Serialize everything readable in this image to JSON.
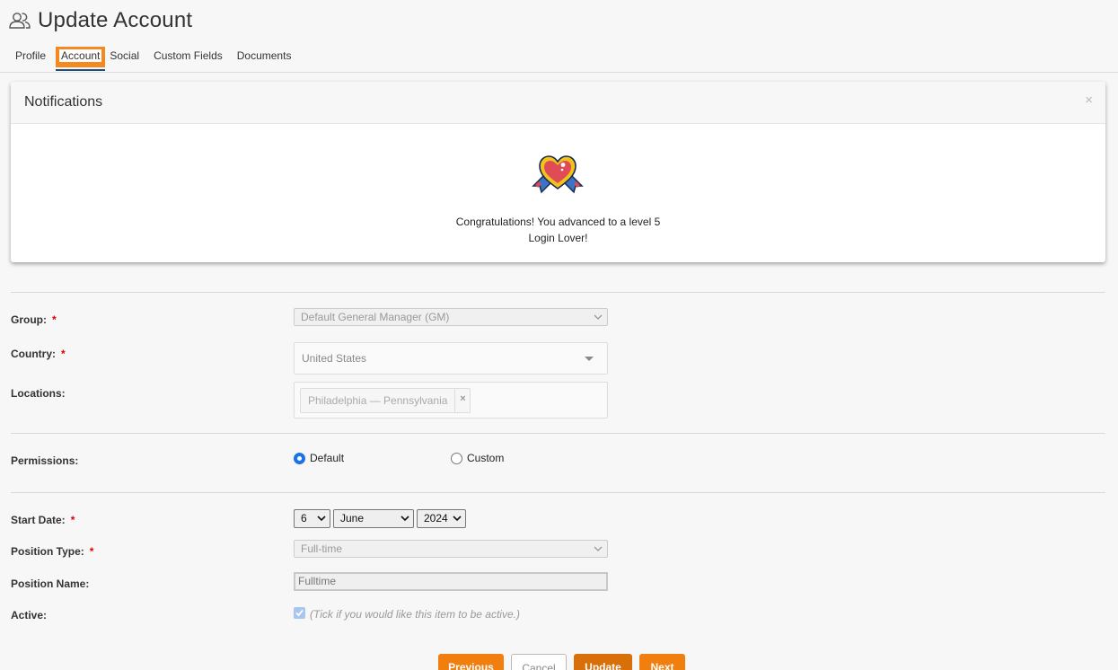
{
  "header": {
    "title": "Update Account",
    "icon": "users-icon"
  },
  "tabs": [
    {
      "label": "Profile",
      "active": false
    },
    {
      "label": "Account",
      "active": true
    },
    {
      "label": "Social",
      "active": false
    },
    {
      "label": "Custom Fields",
      "active": false
    },
    {
      "label": "Documents",
      "active": false
    }
  ],
  "notification": {
    "title": "Notifications",
    "close": "×",
    "badge_icon": "heart-ribbon-badge-icon",
    "message_line1": "Congratulations! You advanced to a level 5",
    "message_line2": "Login Lover!"
  },
  "form": {
    "group": {
      "label": "Group:",
      "required": "*",
      "value": "Default General Manager (GM)"
    },
    "country": {
      "label": "Country:",
      "required": "*",
      "value": "United States"
    },
    "locations": {
      "label": "Locations:",
      "chip": "Philadelphia — Pennsylvania",
      "chip_remove": "×"
    },
    "permissions": {
      "label": "Permissions:",
      "options": [
        "Default",
        "Custom"
      ],
      "selected": "Default"
    },
    "start_date": {
      "label": "Start Date:",
      "required": "*",
      "day": "6",
      "month": "June",
      "year": "2024"
    },
    "position_type": {
      "label": "Position Type:",
      "required": "*",
      "value": "Full-time"
    },
    "position_name": {
      "label": "Position Name:",
      "value": "Fulltime"
    },
    "active": {
      "label": "Active:",
      "checked": true,
      "hint": "(Tick if you would like this item to be active.)"
    }
  },
  "buttons": {
    "previous": "Previous",
    "cancel": "Cancel",
    "update": "Update",
    "next": "Next"
  },
  "colors": {
    "accent": "#f5891f",
    "tab_underline": "#1e4e7a",
    "required": "#dd0000",
    "radio": "#1a73e8"
  }
}
